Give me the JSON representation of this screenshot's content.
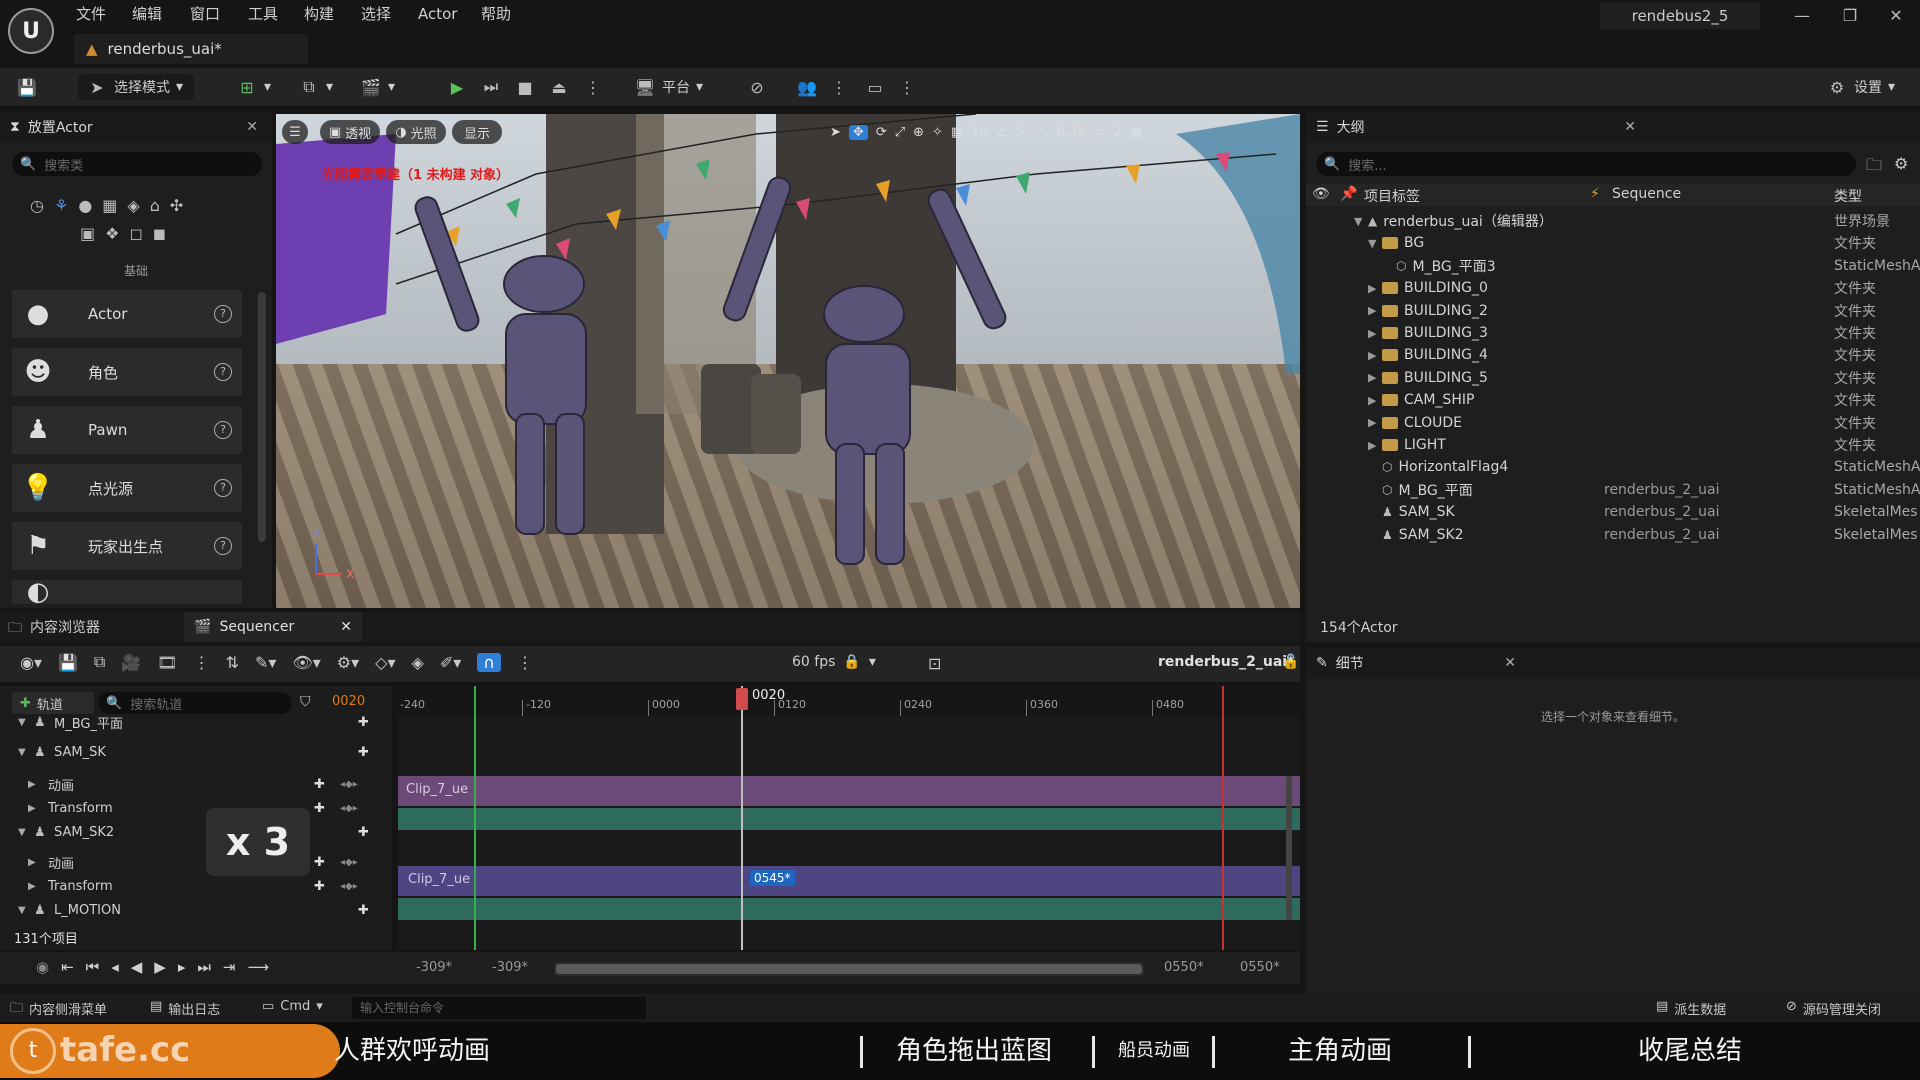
{
  "app": {
    "menu": [
      "文件",
      "编辑",
      "窗口",
      "工具",
      "构建",
      "选择",
      "Actor",
      "帮助"
    ],
    "doc_tab": "renderbus_uai*",
    "window_title": "rendebus2_5",
    "settings_label": "设置"
  },
  "toolbar": {
    "select_mode": "选择模式",
    "platform": "平台"
  },
  "place_actors": {
    "tab_title": "放置Actor",
    "search_placeholder": "搜索类",
    "category": "基础",
    "items": [
      {
        "label": "Actor",
        "icon": "sphere-icon"
      },
      {
        "label": "角色",
        "icon": "character-icon"
      },
      {
        "label": "Pawn",
        "icon": "pawn-icon"
      },
      {
        "label": "点光源",
        "icon": "point-light-icon"
      },
      {
        "label": "玩家出生点",
        "icon": "player-start-icon"
      }
    ]
  },
  "viewport": {
    "perspective": "透视",
    "lighting": "光照",
    "show": "显示",
    "warning": "光照需要重建（1 未构建 对象）",
    "grid_snap": "10",
    "angle_snap": "5°",
    "scale_snap": "0.25",
    "camera_speed": "2"
  },
  "outliner": {
    "tab_title": "大纲",
    "search_placeholder": "搜索...",
    "col_label": "项目标签",
    "col_sequence": "Sequence",
    "col_type": "类型",
    "rows": [
      {
        "label": "renderbus_uai（编辑器）",
        "type": "世界场景",
        "sequence": "",
        "indent": 0,
        "kind": "world"
      },
      {
        "label": "BG",
        "type": "文件夹",
        "sequence": "",
        "indent": 1,
        "kind": "folder-open"
      },
      {
        "label": "M_BG_平面3",
        "type": "StaticMeshA",
        "sequence": "",
        "indent": 2,
        "kind": "mesh"
      },
      {
        "label": "BUILDING_0",
        "type": "文件夹",
        "sequence": "",
        "indent": 1,
        "kind": "folder"
      },
      {
        "label": "BUILDING_2",
        "type": "文件夹",
        "sequence": "",
        "indent": 1,
        "kind": "folder"
      },
      {
        "label": "BUILDING_3",
        "type": "文件夹",
        "sequence": "",
        "indent": 1,
        "kind": "folder"
      },
      {
        "label": "BUILDING_4",
        "type": "文件夹",
        "sequence": "",
        "indent": 1,
        "kind": "folder"
      },
      {
        "label": "BUILDING_5",
        "type": "文件夹",
        "sequence": "",
        "indent": 1,
        "kind": "folder"
      },
      {
        "label": "CAM_SHIP",
        "type": "文件夹",
        "sequence": "",
        "indent": 1,
        "kind": "folder"
      },
      {
        "label": "CLOUDE",
        "type": "文件夹",
        "sequence": "",
        "indent": 1,
        "kind": "folder"
      },
      {
        "label": "LIGHT",
        "type": "文件夹",
        "sequence": "",
        "indent": 1,
        "kind": "folder"
      },
      {
        "label": "HorizontalFlag4",
        "type": "StaticMeshA",
        "sequence": "",
        "indent": 1,
        "kind": "mesh"
      },
      {
        "label": "M_BG_平面",
        "type": "StaticMeshA",
        "sequence": "renderbus_2_uai",
        "indent": 1,
        "kind": "mesh"
      },
      {
        "label": "SAM_SK",
        "type": "SkeletalMes",
        "sequence": "renderbus_2_uai",
        "indent": 1,
        "kind": "skeletal"
      },
      {
        "label": "SAM_SK2",
        "type": "SkeletalMes",
        "sequence": "renderbus_2_uai",
        "indent": 1,
        "kind": "skeletal"
      }
    ],
    "actor_count": "154个Actor"
  },
  "details": {
    "tab_title": "细节",
    "empty_hint": "选择一个对象来查看细节。"
  },
  "bottom_tabs": {
    "content_browser": "内容浏览器",
    "sequencer": "Sequencer"
  },
  "sequencer": {
    "fps": "60 fps",
    "sequence_name": "renderbus_2_uai*",
    "add_track": "轨道",
    "search_placeholder": "搜索轨道",
    "current_frame": "0020",
    "playhead_label": "0020",
    "ruler_labels": [
      "-240",
      "-120",
      "0000",
      "0120",
      "0240",
      "0360",
      "0480"
    ],
    "tracks": [
      {
        "label": "M_BG_平面",
        "level": 0
      },
      {
        "label": "SAM_SK",
        "level": 0
      },
      {
        "label": "动画",
        "level": 1
      },
      {
        "label": "Transform",
        "level": 1
      },
      {
        "label": "SAM_SK2",
        "level": 0
      },
      {
        "label": "动画",
        "level": 1
      },
      {
        "label": "Transform",
        "level": 1
      },
      {
        "label": "L_MOTION",
        "level": 0
      }
    ],
    "item_count": "131个项目",
    "clip1": "Clip_7_ue",
    "clip2": "Clip_7_ue",
    "clip2_marker": "0545*",
    "overlay": "x 3",
    "range_start_a": "-309*",
    "range_start_b": "-309*",
    "range_end_a": "0550*",
    "range_end_b": "0550*"
  },
  "statusbar": {
    "content_drawer": "内容侧滑菜单",
    "output_log": "输出日志",
    "cmd": "Cmd",
    "console_placeholder": "输入控制台命令",
    "derived_data": "派生数据",
    "source_control": "源码管理关闭"
  },
  "captions": {
    "logo": "tafe.cc",
    "items": [
      "人群欢呼动画",
      "角色拖出蓝图",
      "船员动画",
      "主角动画",
      "收尾总结"
    ]
  },
  "colors": {
    "accent_blue": "#2f7fd8",
    "anim_track": "#6b4a7a",
    "transform_track": "#2e6b5c",
    "playhead": "#d34a4a",
    "range_start": "#35b04a",
    "range_end": "#c83232",
    "caption_orange": "#e07b1a"
  }
}
